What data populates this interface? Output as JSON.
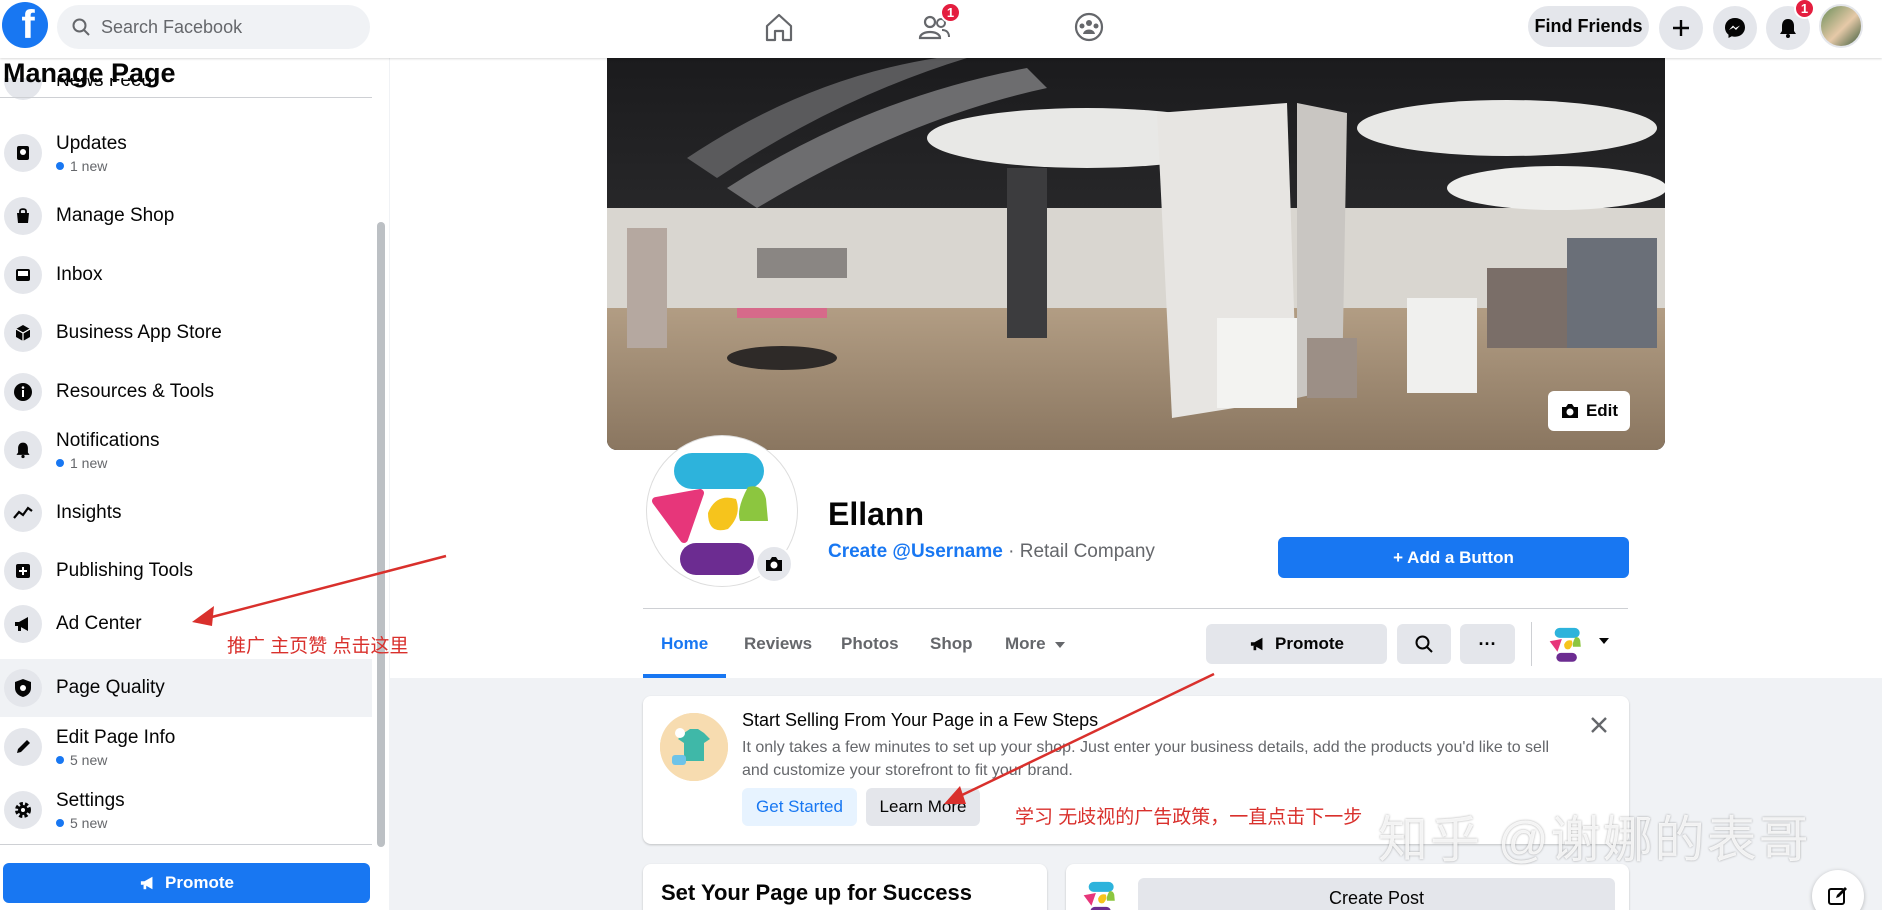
{
  "topbar": {
    "logo_letter": "f",
    "search_placeholder": "Search Facebook",
    "friends_badge": "1",
    "notif_badge": "1",
    "find_friends": "Find Friends"
  },
  "sidebar": {
    "title": "Manage Page",
    "partial_item": "News Feed",
    "items": [
      {
        "label": "Updates",
        "sub": "1 new"
      },
      {
        "label": "Manage Shop",
        "sub": ""
      },
      {
        "label": "Inbox",
        "sub": ""
      },
      {
        "label": "Business App Store",
        "sub": ""
      },
      {
        "label": "Resources & Tools",
        "sub": ""
      },
      {
        "label": "Notifications",
        "sub": "1 new"
      },
      {
        "label": "Insights",
        "sub": ""
      },
      {
        "label": "Publishing Tools",
        "sub": ""
      },
      {
        "label": "Ad Center",
        "sub": ""
      },
      {
        "label": "Page Quality",
        "sub": ""
      },
      {
        "label": "Edit Page Info",
        "sub": "5 new"
      },
      {
        "label": "Settings",
        "sub": "5 new"
      }
    ],
    "promote": "Promote"
  },
  "page": {
    "edit_cover": "Edit",
    "name": "Ellann",
    "username_link": "Create @Username",
    "category_sep": " · ",
    "category": "Retail Company",
    "add_button": "+ Add a Button",
    "tabs": [
      "Home",
      "Reviews",
      "Photos",
      "Shop",
      "More"
    ],
    "promote": "Promote",
    "more_dots": "···"
  },
  "sell_card": {
    "title": "Start Selling From Your Page in a Few Steps",
    "desc": "It only takes a few minutes to set up your shop. Just enter your business details, add the products you'd like to sell and customize your storefront to fit your brand.",
    "get_started": "Get Started",
    "learn_more": "Learn More"
  },
  "setup_card": {
    "title": "Set Your Page up for Success"
  },
  "create_post": "Create Post",
  "annotations": {
    "left": "推广 主页赞 点击这里",
    "right": "学习 无歧视的广告政策，一直点击下一步",
    "watermark": "知乎 @谢娜的表哥"
  },
  "colors": {
    "brand": "#1877f2",
    "annotation": "#d9302c",
    "badge": "#e41e3f"
  }
}
